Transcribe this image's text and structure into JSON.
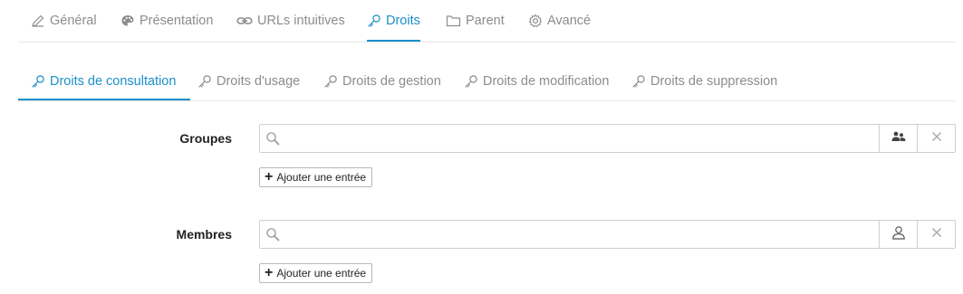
{
  "main_tabs": [
    {
      "label": "Général",
      "icon": "pencil-icon"
    },
    {
      "label": "Présentation",
      "icon": "palette-icon"
    },
    {
      "label": "URLs intuitives",
      "icon": "link-icon"
    },
    {
      "label": "Droits",
      "icon": "key-icon",
      "active": true
    },
    {
      "label": "Parent",
      "icon": "folder-icon"
    },
    {
      "label": "Avancé",
      "icon": "gear-icon"
    }
  ],
  "sub_tabs": [
    {
      "label": "Droits de consultation",
      "active": true
    },
    {
      "label": "Droits d'usage"
    },
    {
      "label": "Droits de gestion"
    },
    {
      "label": "Droits de modification"
    },
    {
      "label": "Droits de suppression"
    }
  ],
  "groups": {
    "label": "Groupes",
    "value": "",
    "placeholder": "",
    "add_label": "Ajouter une entrée"
  },
  "members": {
    "label": "Membres",
    "value": "",
    "placeholder": "",
    "add_label": "Ajouter une entrée"
  },
  "colors": {
    "accent": "#1a8fc9",
    "inactive": "#8c8c8c"
  }
}
